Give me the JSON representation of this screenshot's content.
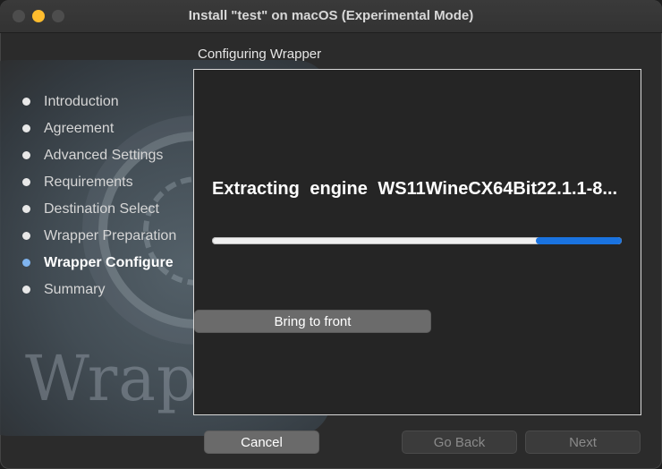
{
  "window": {
    "title": "Install \"test\" on macOS (Experimental Mode)"
  },
  "art": {
    "word": "Wrapper"
  },
  "sidebar": {
    "steps": [
      {
        "label": "Introduction",
        "state": "done"
      },
      {
        "label": "Agreement",
        "state": "done"
      },
      {
        "label": "Advanced Settings",
        "state": "done"
      },
      {
        "label": "Requirements",
        "state": "done"
      },
      {
        "label": "Destination Select",
        "state": "done"
      },
      {
        "label": "Wrapper Preparation",
        "state": "done"
      },
      {
        "label": "Wrapper Configure",
        "state": "active"
      },
      {
        "label": "Summary",
        "state": "pending"
      }
    ]
  },
  "main": {
    "section_title": "Configuring Wrapper",
    "status_text": "Extracting engine WS11WineCX64Bit22.1.1-8...",
    "progress": {
      "segment_start_pct": 79,
      "segment_end_pct": 100,
      "indeterminate": true
    },
    "bring_to_front_label": "Bring to front"
  },
  "footer": {
    "cancel_label": "Cancel",
    "back_label": "Go Back",
    "next_label": "Next"
  },
  "colors": {
    "accent": "#1a73e0",
    "active_dot": "#7fb4ef",
    "minimize_button": "#febc2e"
  }
}
